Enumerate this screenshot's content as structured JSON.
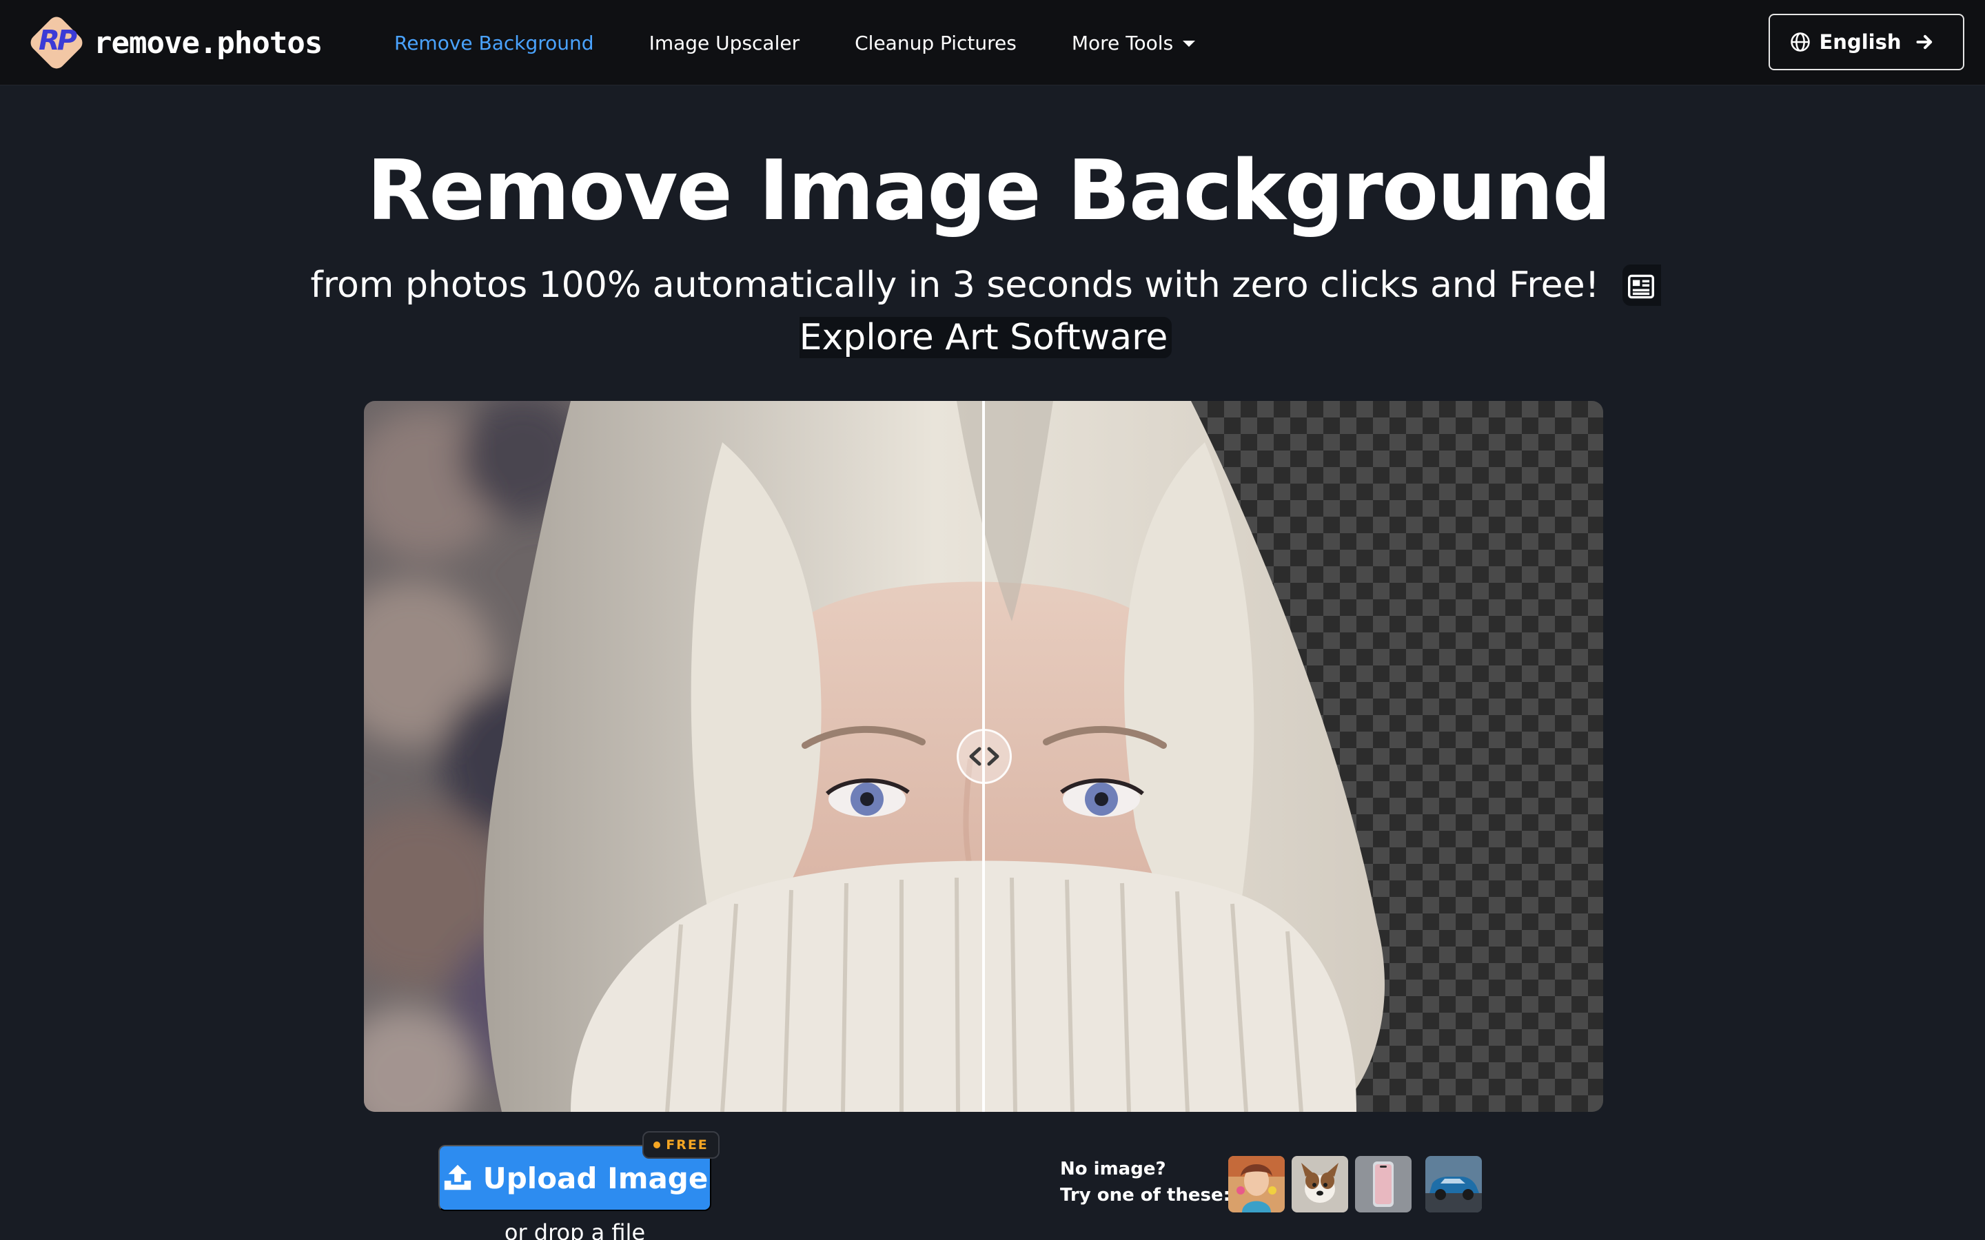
{
  "brand": {
    "logo_letters": "RP",
    "name": "remove.photos"
  },
  "nav": {
    "items": [
      {
        "label": "Remove Background",
        "active": true
      },
      {
        "label": "Image Upscaler",
        "active": false
      },
      {
        "label": "Cleanup Pictures",
        "active": false
      },
      {
        "label": "More Tools",
        "active": false,
        "dropdown": true
      }
    ],
    "language": "English"
  },
  "hero": {
    "title": "Remove Image Background",
    "subtitle": "from photos 100% automatically in 3 seconds with zero clicks and Free!",
    "explore_link": "Explore Art Software"
  },
  "compare": {
    "split_fraction": 0.5,
    "icon": "compare-handle-icon"
  },
  "upload": {
    "button_label": "Upload Image",
    "badge": "FREE",
    "drop_text": "or drop a file"
  },
  "samples": {
    "line1": "No image?",
    "line2": "Try one of these:",
    "thumbnails": [
      "sample-woman",
      "sample-dog",
      "sample-phone",
      "sample-car"
    ]
  },
  "colors": {
    "accent": "#2d8cf0",
    "active_link": "#4aa3ff",
    "badge": "#f5a623",
    "background": "#181c24",
    "navbar": "#0f1013"
  }
}
